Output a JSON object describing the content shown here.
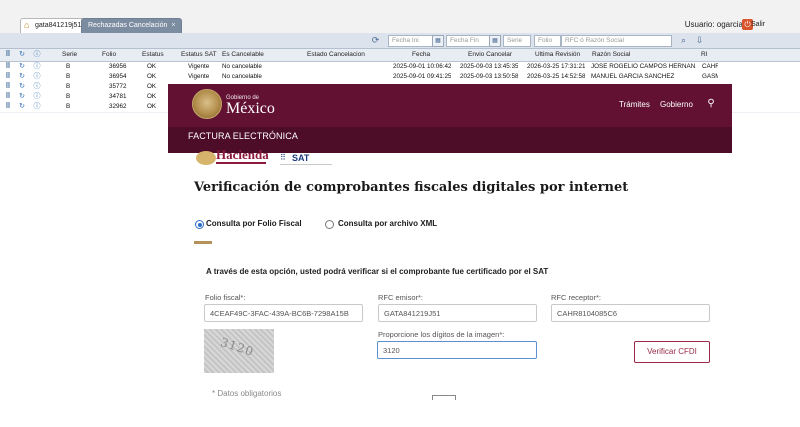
{
  "app": {
    "tabs": [
      "gata841219j51",
      "Rechazadas Cancelación"
    ],
    "tab_close": "×",
    "user_label": "Usuario: ogarcia",
    "logout_label": "Salir",
    "filters": {
      "fecha_ini": "Fecha Ini",
      "fecha_fin": "Fecha Fin",
      "serie": "Serie",
      "folio": "Folio",
      "rfc": "RFC ó Razón Social"
    },
    "columns": [
      "Serie",
      "Folio",
      "Estatus",
      "Estatus SAT",
      "Es Cancelable",
      "Estado Cancelacion",
      "Fecha",
      "Envio Cancelar",
      "Ultima Revisión",
      "Razón Social",
      "RI"
    ],
    "rows": [
      {
        "serie": "B",
        "folio": "36956",
        "estatus": "OK",
        "estatus_sat": "Vigente",
        "cancelable": "No cancelable",
        "estado": "",
        "fecha": "2025-09-01 10:06:42",
        "envio": "2025-09-03 13:45:35",
        "ultima": "2026-03-25 17:31:21",
        "razon": "JOSE ROGELIO CAMPOS HERNAN...",
        "ri": "CAHR"
      },
      {
        "serie": "B",
        "folio": "36954",
        "estatus": "OK",
        "estatus_sat": "Vigente",
        "cancelable": "No cancelable",
        "estado": "",
        "fecha": "2025-09-01 09:41:25",
        "envio": "2025-09-03 13:50:58",
        "ultima": "2026-03-25 14:52:58",
        "razon": "MANUEL GARCIA SANCHEZ",
        "ri": "GASM"
      },
      {
        "serie": "B",
        "folio": "35772",
        "estatus": "OK",
        "estatus_sat": "",
        "cancelable": "",
        "estado": "",
        "fecha": "",
        "envio": "",
        "ultima": "",
        "razon": "",
        "ri": ""
      },
      {
        "serie": "B",
        "folio": "34781",
        "estatus": "OK",
        "estatus_sat": "",
        "cancelable": "",
        "estado": "",
        "fecha": "",
        "envio": "",
        "ultima": "",
        "razon": "",
        "ri": ""
      },
      {
        "serie": "B",
        "folio": "32962",
        "estatus": "OK",
        "estatus_sat": "",
        "cancelable": "",
        "estado": "",
        "fecha": "",
        "envio": "",
        "ultima": "",
        "razon": "",
        "ri": ""
      }
    ]
  },
  "sat": {
    "gob_small": "Gobierno de",
    "gob_big": "México",
    "nav": [
      "Trámites",
      "Gobierno"
    ],
    "subbar_title": "FACTURA ELECTRÓNICA",
    "hacienda": "Hacienda",
    "sat_logo": "SAT",
    "title": "Verificación de comprobantes fiscales digitales por internet",
    "radios": [
      "Consulta por Folio Fiscal",
      "Consulta por archivo XML"
    ],
    "intro": "A través de esta opción, usted podrá verificar si el comprobante fue certificado por el SAT",
    "fields": {
      "folio_label": "Folio fiscal*:",
      "folio_value": "4CEAF49C-3FAC-439A-BC6B-7298A15B",
      "emisor_label": "RFC emisor*:",
      "emisor_value": "GATA841219J51",
      "receptor_label": "RFC receptor*:",
      "receptor_value": "CAHR8104085C6",
      "captcha_label": "Proporcione los dígitos de la imagen*:",
      "captcha_value": "3120",
      "captcha_image_text": "3120"
    },
    "verify_button": "Verificar CFDI",
    "required_note": "* Datos obligatorios",
    "colors": {
      "guinda": "#621132",
      "guinda_dark": "#4d0c28",
      "gold": "#b6925b"
    }
  }
}
